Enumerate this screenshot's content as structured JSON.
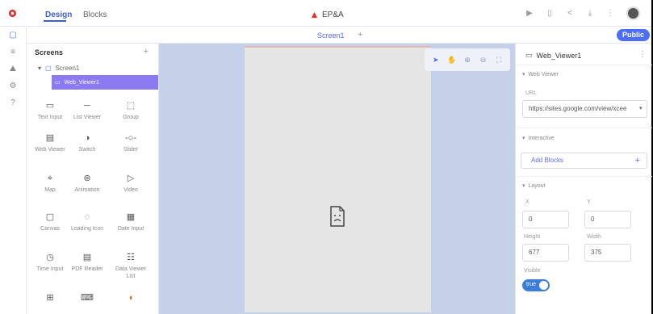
{
  "topbar": {
    "tabs": [
      {
        "label": "Design",
        "active": true
      },
      {
        "label": "Blocks",
        "active": false
      }
    ],
    "project_name": "EP&A",
    "tools": [
      "play-icon",
      "device-icon",
      "share-icon",
      "download-icon",
      "more-vertical-icon"
    ],
    "accent": "#3b5bdb"
  },
  "screenbar": {
    "screen_tab": "Screen1",
    "add": "+",
    "public_label": "Public"
  },
  "rail": {
    "icons": [
      "screen-icon",
      "database-icon",
      "assets-icon",
      "settings-icon",
      "help-icon"
    ]
  },
  "screens_panel": {
    "title": "Screens",
    "add": "+",
    "tree": [
      {
        "label": "Screen1"
      },
      {
        "label": "Web_Viewer1",
        "selected": true
      }
    ],
    "components": [
      {
        "label": "Text Input",
        "icon": "text-input-icon"
      },
      {
        "label": "List Viewer",
        "icon": "list-viewer-icon"
      },
      {
        "label": "Group",
        "icon": "group-icon"
      },
      {
        "label": "Web Viewer",
        "icon": "web-viewer-icon"
      },
      {
        "label": "Switch",
        "icon": "switch-icon"
      },
      {
        "label": "Slider",
        "icon": "slider-icon"
      },
      {
        "label": "Map",
        "icon": "map-icon"
      },
      {
        "label": "Animation",
        "icon": "animation-icon"
      },
      {
        "label": "Video",
        "icon": "video-icon"
      },
      {
        "label": "Canvas",
        "icon": "canvas-icon"
      },
      {
        "label": "Loading Icon",
        "icon": "loading-icon"
      },
      {
        "label": "Date Input",
        "icon": "date-input-icon"
      },
      {
        "label": "Time Input",
        "icon": "time-input-icon"
      },
      {
        "label": "PDF Reader",
        "icon": "pdf-reader-icon"
      },
      {
        "label": "Data Viewer List",
        "icon": "data-viewer-list-icon"
      },
      {
        "label": "",
        "icon": "grid-icon"
      },
      {
        "label": "",
        "icon": "keyboard-icon"
      },
      {
        "label": "",
        "icon": "brand-icon"
      }
    ]
  },
  "canvas": {
    "tools": [
      "select-icon",
      "hand-icon",
      "zoom-in-icon",
      "zoom-out-icon",
      "fit-icon"
    ]
  },
  "props": {
    "title": "Web_Viewer1",
    "section_webviewer": "Web Viewer",
    "url_label": "URL",
    "url_value": "https://sites.google.com/view/xcee",
    "section_interactive": "Interactive",
    "add_blocks": "Add Blocks",
    "section_layout": "Layout",
    "x_label": "X",
    "x_value": "0",
    "y_label": "Y",
    "y_value": "0",
    "height_label": "Height",
    "height_value": "677",
    "width_label": "Width",
    "width_value": "375",
    "visible_label": "Visible",
    "visible_value": "true"
  }
}
